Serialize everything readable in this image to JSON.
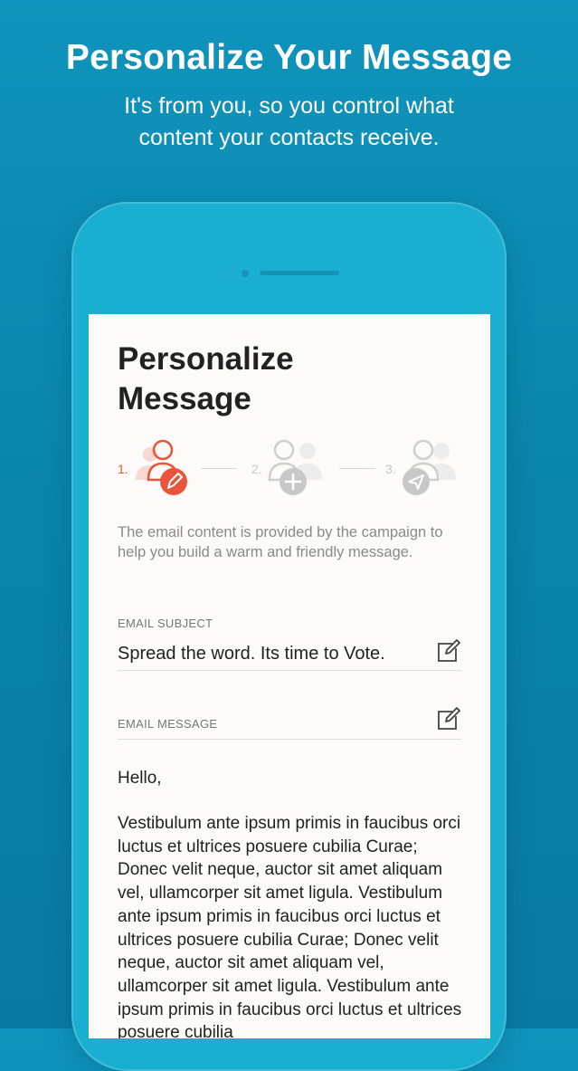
{
  "promo": {
    "title": "Personalize Your Message",
    "subtitle_line1": "It's from you, so you control what",
    "subtitle_line2": "content your contacts receive."
  },
  "screen": {
    "title_line1": "Personalize",
    "title_line2": "Message",
    "steps": [
      {
        "number": "1.",
        "icon": "pen-icon",
        "status": "active",
        "color": "#e8553a"
      },
      {
        "number": "2.",
        "icon": "plus-icon",
        "status": "inactive",
        "color": "#c8c8c8"
      },
      {
        "number": "3.",
        "icon": "send-icon",
        "status": "inactive",
        "color": "#c8c8c8"
      }
    ],
    "intro": "The email content is provided by the campaign to help you build a warm and friendly message.",
    "subject": {
      "label": "EMAIL SUBJECT",
      "value": "Spread the word. Its time to Vote.",
      "edit_icon": "edit-icon"
    },
    "message": {
      "label": "EMAIL MESSAGE",
      "edit_icon": "edit-icon",
      "greeting": "Hello,",
      "body": "Vestibulum ante ipsum primis in faucibus orci luctus et ultrices posuere cubilia Curae; Donec velit neque, auctor sit amet aliquam vel, ullamcorper sit amet ligula. Vestibulum ante ipsum primis in faucibus orci luctus et ultrices posuere cubilia Curae; Donec velit neque, auctor sit amet aliquam vel, ullamcorper sit amet ligula. Vestibulum ante ipsum primis in faucibus orci luctus et ultrices posuere cubilia"
    }
  },
  "colors": {
    "background": "#0a85aa",
    "phone": "#1aaed0",
    "accent": "#e8553a",
    "inactive": "#c8c8c8"
  }
}
